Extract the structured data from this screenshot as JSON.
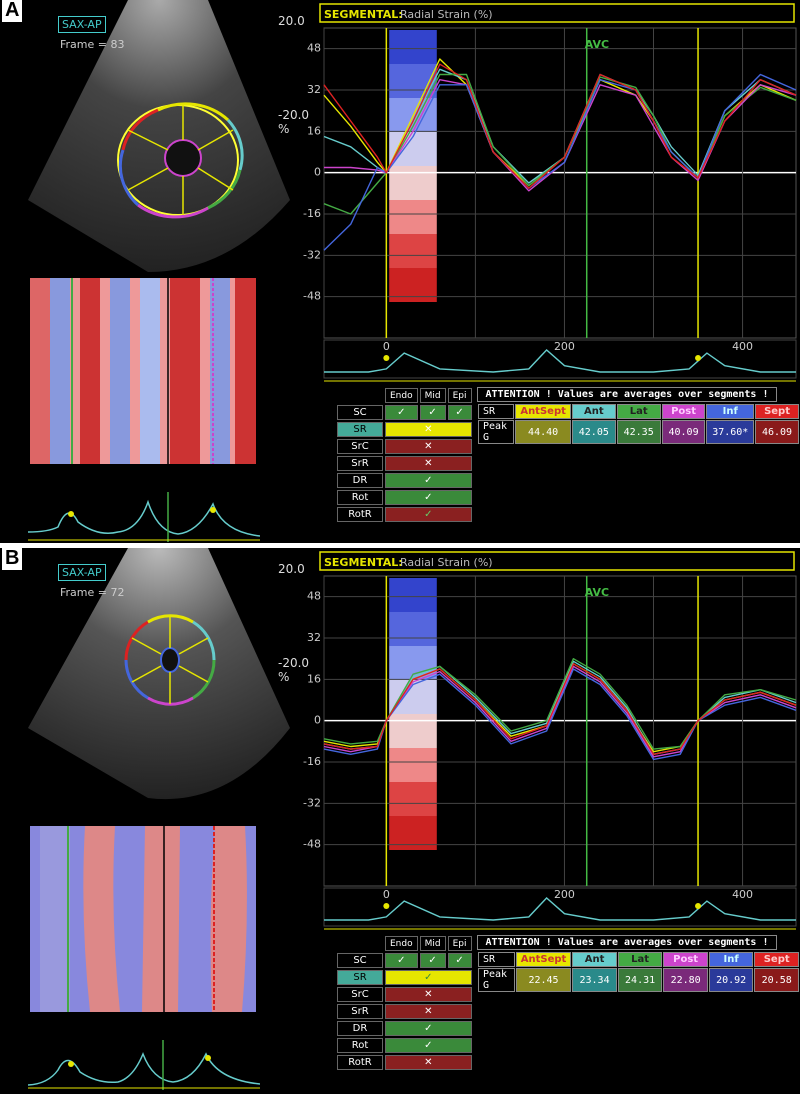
{
  "panels": [
    {
      "label": "A",
      "mode": "SAX-AP",
      "frame": "Frame = 83",
      "scale_max": "20.0",
      "scale_min": "-20.0",
      "scale_unit": "%",
      "table": {
        "headers": [
          "Endo",
          "Mid",
          "Epi"
        ],
        "rows": [
          {
            "label": "SC",
            "cells": [
              "ok",
              "ok",
              "ok"
            ]
          },
          {
            "label": "SR",
            "cells": [
              "bad-yellow"
            ],
            "selected": true
          },
          {
            "label": "SrC",
            "cells": [
              "bad"
            ]
          },
          {
            "label": "SrR",
            "cells": [
              "bad"
            ]
          },
          {
            "label": "DR",
            "cells": [
              "ok"
            ]
          },
          {
            "label": "Rot",
            "cells": [
              "ok"
            ]
          },
          {
            "label": "RotR",
            "cells": [
              "ok-red"
            ]
          }
        ]
      },
      "attention": "ATTENTION !  Values are averages over segments !",
      "seg_header": [
        "SR",
        "AntSept",
        "Ant",
        "Lat",
        "Post",
        "Inf",
        "Sept"
      ],
      "seg_row_label": "Peak G",
      "seg_values": [
        "44.40",
        "42.05",
        "42.35",
        "40.09",
        "37.60*",
        "46.09"
      ]
    },
    {
      "label": "B",
      "mode": "SAX-AP",
      "frame": "Frame = 72",
      "scale_max": "20.0",
      "scale_min": "-20.0",
      "scale_unit": "%",
      "table": {
        "headers": [
          "Endo",
          "Mid",
          "Epi"
        ],
        "rows": [
          {
            "label": "SC",
            "cells": [
              "ok",
              "ok",
              "ok"
            ]
          },
          {
            "label": "SR",
            "cells": [
              "ok-yellow"
            ],
            "selected": true
          },
          {
            "label": "SrC",
            "cells": [
              "bad"
            ]
          },
          {
            "label": "SrR",
            "cells": [
              "bad"
            ]
          },
          {
            "label": "DR",
            "cells": [
              "ok"
            ]
          },
          {
            "label": "Rot",
            "cells": [
              "ok"
            ]
          },
          {
            "label": "RotR",
            "cells": [
              "bad"
            ]
          }
        ]
      },
      "attention": "ATTENTION !  Values are averages over segments !",
      "seg_header": [
        "SR",
        "AntSept",
        "Ant",
        "Lat",
        "Post",
        "Inf",
        "Sept"
      ],
      "seg_row_label": "Peak G",
      "seg_values": [
        "22.45",
        "23.34",
        "24.31",
        "22.80",
        "20.92",
        "20.58"
      ]
    }
  ],
  "segment_colors": {
    "AntSept": "#e6e600",
    "Ant": "#66cccc",
    "Lat": "#44aa44",
    "Post": "#cc44cc",
    "Inf": "#4466dd",
    "Sept": "#dd2222"
  },
  "chart_data": [
    {
      "type": "line",
      "title": "SEGMENTAL:",
      "subtitle": "Radial Strain (%)",
      "ylim": [
        -64,
        56
      ],
      "yticks": [
        48,
        32,
        16,
        0,
        -16,
        -32,
        -48
      ],
      "xlim": [
        -70,
        460
      ],
      "xticks": [
        0,
        200,
        400
      ],
      "markers": [
        {
          "x": 0,
          "label": ""
        },
        {
          "x": 225,
          "label": "AVC"
        },
        {
          "x": 350,
          "label": ""
        }
      ],
      "series": [
        {
          "name": "AntSept",
          "x": [
            -70,
            -40,
            -10,
            0,
            30,
            60,
            90,
            120,
            160,
            200,
            240,
            280,
            300,
            320,
            350,
            380,
            420,
            460
          ],
          "y": [
            30,
            18,
            4,
            0,
            22,
            44,
            34,
            8,
            -5,
            6,
            36,
            30,
            20,
            8,
            -2,
            22,
            34,
            28
          ]
        },
        {
          "name": "Ant",
          "x": [
            -70,
            -40,
            -10,
            0,
            30,
            60,
            90,
            120,
            160,
            200,
            240,
            280,
            300,
            320,
            350,
            380,
            420,
            460
          ],
          "y": [
            14,
            10,
            2,
            0,
            20,
            40,
            36,
            10,
            -4,
            6,
            38,
            32,
            22,
            10,
            -1,
            24,
            36,
            30
          ]
        },
        {
          "name": "Lat",
          "x": [
            -70,
            -40,
            -10,
            0,
            30,
            60,
            90,
            120,
            160,
            200,
            240,
            280,
            300,
            320,
            350,
            380,
            420,
            460
          ],
          "y": [
            -12,
            -16,
            -4,
            0,
            18,
            38,
            38,
            10,
            -5,
            6,
            37,
            33,
            22,
            8,
            -2,
            22,
            33,
            28
          ]
        },
        {
          "name": "Post",
          "x": [
            -70,
            -40,
            -10,
            0,
            30,
            60,
            90,
            120,
            160,
            200,
            240,
            280,
            300,
            320,
            350,
            380,
            420,
            460
          ],
          "y": [
            2,
            2,
            1,
            0,
            16,
            36,
            34,
            8,
            -7,
            4,
            34,
            30,
            18,
            6,
            -3,
            20,
            34,
            30
          ]
        },
        {
          "name": "Inf",
          "x": [
            -70,
            -40,
            -10,
            0,
            30,
            60,
            90,
            120,
            160,
            200,
            240,
            280,
            300,
            320,
            350,
            380,
            420,
            460
          ],
          "y": [
            -30,
            -20,
            2,
            0,
            14,
            34,
            34,
            8,
            -6,
            4,
            36,
            32,
            20,
            8,
            -2,
            24,
            38,
            32
          ]
        },
        {
          "name": "Sept",
          "x": [
            -70,
            -40,
            -10,
            0,
            30,
            60,
            90,
            120,
            160,
            200,
            240,
            280,
            300,
            320,
            350,
            380,
            420,
            460
          ],
          "y": [
            34,
            20,
            6,
            0,
            20,
            42,
            36,
            8,
            -6,
            6,
            38,
            32,
            20,
            6,
            -2,
            20,
            36,
            30
          ]
        }
      ],
      "ecg": {
        "x": [
          -70,
          -20,
          0,
          20,
          60,
          120,
          160,
          180,
          200,
          240,
          300,
          340,
          360,
          380,
          420,
          460
        ],
        "y": [
          0,
          0,
          1,
          6,
          1,
          0,
          1,
          7,
          2,
          0,
          0,
          1,
          6,
          2,
          0,
          0
        ]
      }
    },
    {
      "type": "line",
      "title": "SEGMENTAL:",
      "subtitle": "Radial Strain (%)",
      "ylim": [
        -64,
        56
      ],
      "yticks": [
        48,
        32,
        16,
        0,
        -16,
        -32,
        -48
      ],
      "xlim": [
        -70,
        460
      ],
      "xticks": [
        0,
        200,
        400
      ],
      "markers": [
        {
          "x": 0,
          "label": ""
        },
        {
          "x": 225,
          "label": "AVC"
        },
        {
          "x": 350,
          "label": ""
        }
      ],
      "series": [
        {
          "name": "AntSept",
          "x": [
            -70,
            -40,
            -10,
            0,
            30,
            60,
            100,
            140,
            180,
            210,
            240,
            270,
            300,
            330,
            350,
            380,
            420,
            460
          ],
          "y": [
            -8,
            -10,
            -9,
            0,
            16,
            20,
            8,
            -6,
            -2,
            22,
            16,
            4,
            -12,
            -10,
            0,
            8,
            11,
            6
          ]
        },
        {
          "name": "Ant",
          "x": [
            -70,
            -40,
            -10,
            0,
            30,
            60,
            100,
            140,
            180,
            210,
            240,
            270,
            300,
            330,
            350,
            380,
            420,
            460
          ],
          "y": [
            -9,
            -11,
            -10,
            0,
            17,
            21,
            9,
            -5,
            -1,
            23,
            17,
            5,
            -13,
            -11,
            0,
            9,
            12,
            7
          ]
        },
        {
          "name": "Lat",
          "x": [
            -70,
            -40,
            -10,
            0,
            30,
            60,
            100,
            140,
            180,
            210,
            240,
            270,
            300,
            330,
            350,
            380,
            420,
            460
          ],
          "y": [
            -7,
            -9,
            -8,
            0,
            18,
            21,
            10,
            -4,
            0,
            24,
            18,
            6,
            -11,
            -10,
            0,
            10,
            12,
            8
          ]
        },
        {
          "name": "Post",
          "x": [
            -70,
            -40,
            -10,
            0,
            30,
            60,
            100,
            140,
            180,
            210,
            240,
            270,
            300,
            330,
            350,
            380,
            420,
            460
          ],
          "y": [
            -10,
            -12,
            -10,
            0,
            15,
            19,
            7,
            -8,
            -3,
            21,
            15,
            3,
            -14,
            -12,
            0,
            7,
            10,
            5
          ]
        },
        {
          "name": "Inf",
          "x": [
            -70,
            -40,
            -10,
            0,
            30,
            60,
            100,
            140,
            180,
            210,
            240,
            270,
            300,
            330,
            350,
            380,
            420,
            460
          ],
          "y": [
            -11,
            -13,
            -11,
            0,
            14,
            18,
            6,
            -9,
            -4,
            20,
            14,
            2,
            -15,
            -13,
            0,
            6,
            9,
            4
          ]
        },
        {
          "name": "Sept",
          "x": [
            -70,
            -40,
            -10,
            0,
            30,
            60,
            100,
            140,
            180,
            210,
            240,
            270,
            300,
            330,
            350,
            380,
            420,
            460
          ],
          "y": [
            -9,
            -11,
            -10,
            0,
            16,
            20,
            8,
            -7,
            -2,
            22,
            16,
            4,
            -13,
            -11,
            0,
            8,
            11,
            6
          ]
        }
      ],
      "ecg": {
        "x": [
          -70,
          -20,
          0,
          20,
          60,
          120,
          160,
          180,
          200,
          240,
          300,
          340,
          360,
          380,
          420,
          460
        ],
        "y": [
          0,
          0,
          1,
          6,
          1,
          0,
          1,
          7,
          2,
          0,
          0,
          1,
          6,
          2,
          0,
          0
        ]
      }
    }
  ]
}
